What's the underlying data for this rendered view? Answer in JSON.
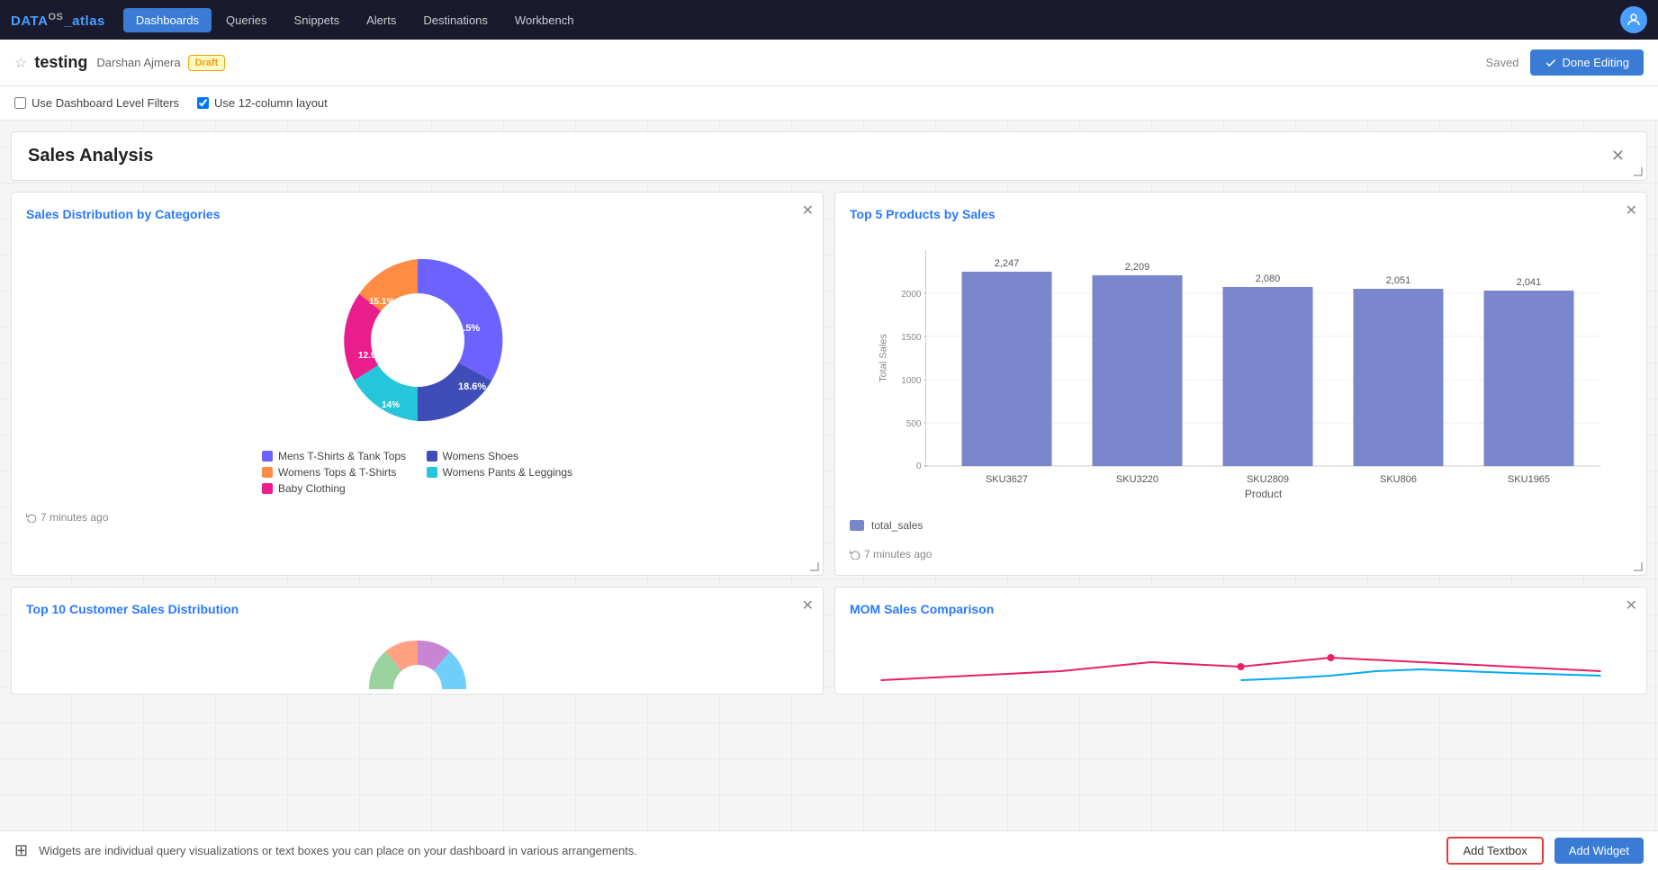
{
  "app": {
    "logo": "DataOS _atlas"
  },
  "nav": {
    "items": [
      {
        "label": "Dashboards",
        "active": true
      },
      {
        "label": "Queries",
        "active": false
      },
      {
        "label": "Snippets",
        "active": false
      },
      {
        "label": "Alerts",
        "active": false
      },
      {
        "label": "Destinations",
        "active": false
      },
      {
        "label": "Workbench",
        "active": false
      }
    ]
  },
  "header": {
    "title": "testing",
    "author": "Darshan Ajmera",
    "badge": "Draft",
    "saved_label": "Saved",
    "done_editing_label": "Done Editing"
  },
  "filters": {
    "dashboard_level_filters": "Use Dashboard Level Filters",
    "column_layout": "Use 12-column layout"
  },
  "section": {
    "title": "Sales Analysis"
  },
  "donut_chart": {
    "title": "Sales Distribution by Categories",
    "refresh": "7 minutes ago",
    "segments": [
      {
        "label": "Mens T-Shirts & Tank Tops",
        "value": 39.5,
        "color": "#6c63ff"
      },
      {
        "label": "Womens Tops & T-Shirts",
        "value": 15.1,
        "color": "#ff8c42"
      },
      {
        "label": "Baby Clothing",
        "value": 12.9,
        "color": "#e91e8c"
      },
      {
        "label": "Womens Shoes",
        "value": 18.6,
        "color": "#3f4db8"
      },
      {
        "label": "Womens Pants & Leggings",
        "value": 14.0,
        "color": "#26c6da"
      }
    ]
  },
  "bar_chart": {
    "title": "Top 5 Products by Sales",
    "refresh": "7 minutes ago",
    "y_axis_label": "Total Sales",
    "x_axis_label": "Product",
    "legend_label": "total_sales",
    "bar_color": "#7986cb",
    "bars": [
      {
        "label": "SKU3627",
        "value": 2247
      },
      {
        "label": "SKU3220",
        "value": 2209
      },
      {
        "label": "SKU2809",
        "value": 2080
      },
      {
        "label": "SKU806",
        "value": 2051
      },
      {
        "label": "SKU1965",
        "value": 2041
      }
    ],
    "y_max": 2500,
    "y_ticks": [
      0,
      500,
      1000,
      1500,
      2000
    ]
  },
  "bottom_widgets": {
    "left_title": "Top 10 Customer Sales Distribution",
    "right_title": "MOM Sales Comparison"
  },
  "bottom_bar": {
    "icon": "⊞",
    "text": "Widgets are individual query visualizations or text boxes you can place on your dashboard in various arrangements.",
    "add_textbox_label": "Add Textbox",
    "add_widget_label": "Add Widget"
  }
}
